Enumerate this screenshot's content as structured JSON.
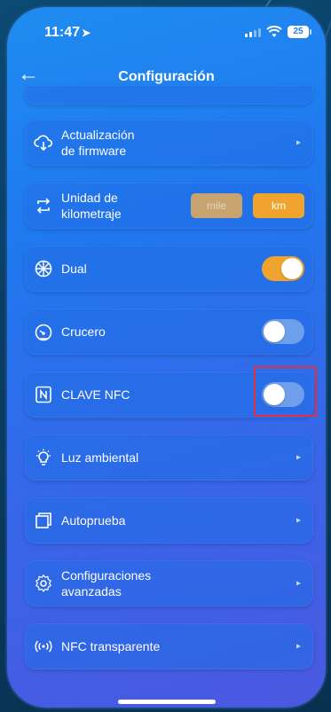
{
  "status_bar": {
    "time": "11:47",
    "location_icon": "location-arrow-icon",
    "battery": "25"
  },
  "header": {
    "title": "Configuración",
    "back_icon": "arrow-left-icon"
  },
  "settings": {
    "firmware": {
      "label_line1": "Actualización",
      "label_line2": "de firmware",
      "icon": "cloud-download-icon"
    },
    "odometer_unit": {
      "label_line1": "Unidad de",
      "label_line2": "kilometraje",
      "icon": "swap-arrows-icon",
      "option_miles": "mile",
      "option_km": "km",
      "selected": "km"
    },
    "dual": {
      "label": "Dual",
      "icon": "wheel-icon",
      "enabled": true
    },
    "cruise": {
      "label": "Crucero",
      "icon": "speedometer-icon",
      "enabled": false
    },
    "nfc_key": {
      "label": "CLAVE NFC",
      "icon": "nfc-card-icon",
      "enabled": false
    },
    "ambient_light": {
      "label": "Luz ambiental",
      "icon": "light-bulb-icon"
    },
    "self_test": {
      "label": "Autoprueba",
      "icon": "square-stack-icon"
    },
    "advanced": {
      "label_line1": "Configuraciones",
      "label_line2": "avanzadas",
      "icon": "gear-icon"
    },
    "nfc_transparent": {
      "label": "NFC transparente",
      "icon": "nfc-waves-icon"
    }
  },
  "colors": {
    "accent": "#f0a42d",
    "highlight": "#e0303d",
    "background": "#1f7fef"
  }
}
